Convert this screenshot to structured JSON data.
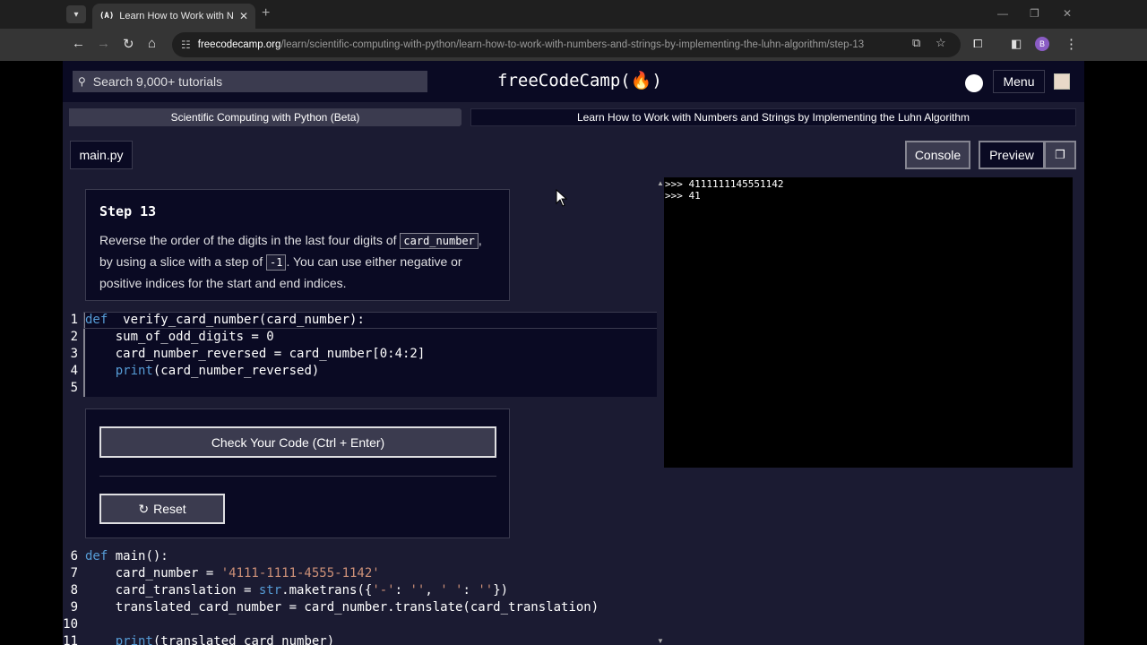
{
  "browser": {
    "tab_favicon": "(A)",
    "tab_title": "Learn How to Work with Numb",
    "url_domain": "freecodecamp.org",
    "url_path": "/learn/scientific-computing-with-python/learn-how-to-work-with-numbers-and-strings-by-implementing-the-luhn-algorithm/step-13",
    "profile_initial": "B"
  },
  "nav": {
    "search_placeholder": "Search 9,000+ tutorials",
    "logo": "freeCodeCamp(🔥)",
    "menu_label": "Menu"
  },
  "breadcrumbs": {
    "course": "Scientific Computing with Python (Beta)",
    "project": "Learn How to Work with Numbers and Strings by Implementing the Luhn Algorithm"
  },
  "toolbar": {
    "file_tab": "main.py",
    "console_label": "Console",
    "preview_label": "Preview"
  },
  "instructions": {
    "title": "Step 13",
    "text_1": "Reverse the order of the digits in the last four digits of ",
    "code_1": "card_number",
    "text_2": ", by using a slice with a step of ",
    "code_2": "-1",
    "text_3": ". You can use either negative or positive indices for the start and end indices."
  },
  "code_top": [
    {
      "n": "1",
      "parts": [
        [
          "kw",
          "def"
        ],
        [
          "",
          "  verify_card_number(card_number):"
        ]
      ]
    },
    {
      "n": "2",
      "parts": [
        [
          "",
          "    sum_of_odd_digits = 0"
        ]
      ]
    },
    {
      "n": "3",
      "parts": [
        [
          "",
          "    card_number_reversed = card_number[0:4:2]"
        ]
      ]
    },
    {
      "n": "4",
      "parts": [
        [
          "",
          "    "
        ],
        [
          "fn",
          "print"
        ],
        [
          "",
          "(card_number_reversed)"
        ]
      ]
    },
    {
      "n": "5",
      "parts": [
        [
          "",
          ""
        ]
      ]
    }
  ],
  "code_bottom": [
    {
      "n": "6",
      "parts": [
        [
          "kw",
          "def"
        ],
        [
          "",
          " main():"
        ]
      ]
    },
    {
      "n": "7",
      "parts": [
        [
          "",
          "    card_number = "
        ],
        [
          "str",
          "'4111-1111-4555-1142'"
        ]
      ]
    },
    {
      "n": "8",
      "parts": [
        [
          "",
          "    card_translation = "
        ],
        [
          "fn",
          "str"
        ],
        [
          "",
          ".maketrans({"
        ],
        [
          "str",
          "'-'"
        ],
        [
          "",
          ": "
        ],
        [
          "str",
          "''"
        ],
        [
          "",
          ", "
        ],
        [
          "str",
          "' '"
        ],
        [
          "",
          ": "
        ],
        [
          "str",
          "''"
        ],
        [
          "",
          "})"
        ]
      ]
    },
    {
      "n": "9",
      "parts": [
        [
          "",
          "    translated_card_number = card_number.translate(card_translation)"
        ]
      ]
    },
    {
      "n": "10",
      "parts": [
        [
          "",
          ""
        ]
      ]
    },
    {
      "n": "11",
      "parts": [
        [
          "",
          "    "
        ],
        [
          "fn",
          "print"
        ],
        [
          "",
          "(translated_card_number)"
        ]
      ]
    }
  ],
  "actions": {
    "check_label": "Check Your Code (Ctrl + Enter)",
    "reset_label": "Reset"
  },
  "console": {
    "lines": [
      ">>> 4111111145551142",
      ">>> 41"
    ]
  }
}
